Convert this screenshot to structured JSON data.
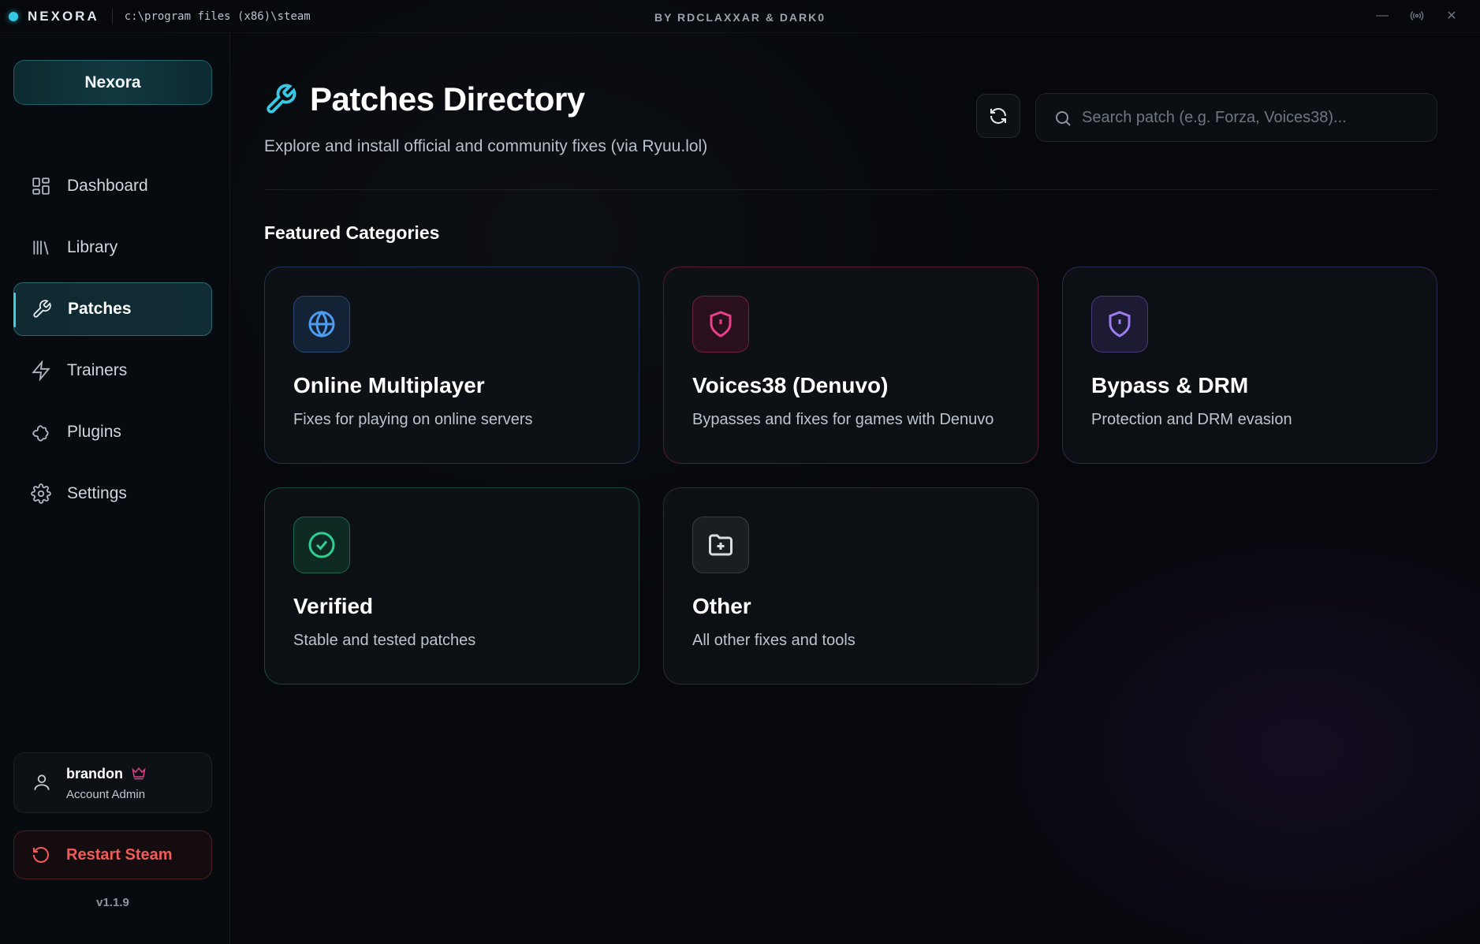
{
  "titlebar": {
    "brand": "NEXORA",
    "path": "c:\\program files (x86)\\steam",
    "credits": "BY RDCLAXXAR & DARK0",
    "minimize_glyph": "—",
    "signal_glyph": "((·))",
    "close_glyph": "✕"
  },
  "sidebar": {
    "brand_button": "Nexora",
    "items": [
      {
        "label": "Dashboard",
        "icon": "dashboard-icon"
      },
      {
        "label": "Library",
        "icon": "library-icon"
      },
      {
        "label": "Patches",
        "icon": "wrench-icon",
        "active": true
      },
      {
        "label": "Trainers",
        "icon": "lightning-icon"
      },
      {
        "label": "Plugins",
        "icon": "puzzle-icon"
      },
      {
        "label": "Settings",
        "icon": "gear-icon"
      }
    ],
    "user": {
      "name": "brandon",
      "role": "Account Admin"
    },
    "restart_label": "Restart Steam",
    "version": "v1.1.9"
  },
  "main": {
    "title": "Patches Directory",
    "subtitle": "Explore and install official and community fixes (via Ryuu.lol)",
    "search_placeholder": "Search patch (e.g. Forza, Voices38)...",
    "section_title": "Featured Categories",
    "categories": [
      {
        "title": "Online Multiplayer",
        "description": "Fixes for playing on online servers",
        "icon": "globe-icon",
        "color": "#4d9cf0"
      },
      {
        "title": "Voices38 (Denuvo)",
        "description": "Bypasses and fixes for games with Denuvo",
        "icon": "shield-alert-icon",
        "color": "#e8408a"
      },
      {
        "title": "Bypass & DRM",
        "description": "Protection and DRM evasion",
        "icon": "shield-alert-icon",
        "color": "#9c7df0"
      },
      {
        "title": "Verified",
        "description": "Stable and tested patches",
        "icon": "check-circle-icon",
        "color": "#2fcf93"
      },
      {
        "title": "Other",
        "description": "All other fixes and tools",
        "icon": "folder-plus-icon",
        "color": "#d9dee4"
      }
    ]
  },
  "colors": {
    "accent": "#39c9e4",
    "danger": "#ef5b5b",
    "background": "#06080b"
  }
}
